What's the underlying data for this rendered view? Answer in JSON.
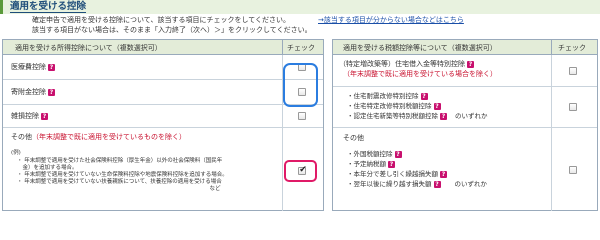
{
  "header": {
    "title": "適用を受ける控除"
  },
  "intro": {
    "line1": "確定申告で適用を受ける控除について、該当する項目にチェックをしてください。",
    "line2": "該当する項目がない場合は、そのまま「入力終了（次へ）＞」をクリックしてください。",
    "help_link": "→該当する項目が分からない場合などはこちら"
  },
  "left_table": {
    "header_label": "適用を受ける所得控除について（複数選択可）",
    "header_check": "チェック",
    "rows": [
      {
        "label": "医療費控除",
        "checked": false
      },
      {
        "label": "寄附金控除",
        "checked": false
      },
      {
        "label": "雑損控除",
        "checked": false
      }
    ],
    "other": {
      "label": "その他",
      "note": "（年末調整で既に適用を受けているものを除く）",
      "checked": true,
      "example_head": "(例)",
      "example_lines": [
        "・ 年末調整で適用を受けた社会保険料控除（厚生年金）以外の社会保険料（国民年",
        "　金）を追加する場合。",
        "・ 年末調整で適用を受けていない生命保険料控除や地震保険料控除を追加する場合。",
        "・ 年末調整で適用を受けていない扶養親族について、扶養控除の適用を受ける場合",
        "　　　　　　　　　　　　　　　　　　　　　　　　　　　　　　　　　　　など"
      ]
    }
  },
  "right_table": {
    "header_label": "適用を受ける税額控除等について（複数選択可）",
    "header_check": "チェック",
    "housing": {
      "label": "（特定増改築等）住宅借入金等特別控除",
      "note": "（年末調整で既に適用を受けている場合を除く）",
      "checked": false
    },
    "renovation": {
      "items": [
        "住宅耐震改修特別控除",
        "住宅特定改修特別税額控除",
        "認定住宅新築等特別税額控除"
      ],
      "suffix": "のいずれか",
      "checked": false
    },
    "other": {
      "label": "その他",
      "items": [
        "外国税額控除",
        "予定納税額",
        "本年分で差し引く繰越損失額",
        "翌年以後に繰り越す損失額"
      ],
      "suffix": "のいずれか",
      "checked": false
    }
  },
  "icons": {
    "help": "?"
  },
  "colors": {
    "accent_red": "#c8102e",
    "help_icon": "#c8106e",
    "highlight_blue": "#2b7de0",
    "highlight_pink": "#e01a67",
    "header_bg": "#e8f2df"
  }
}
